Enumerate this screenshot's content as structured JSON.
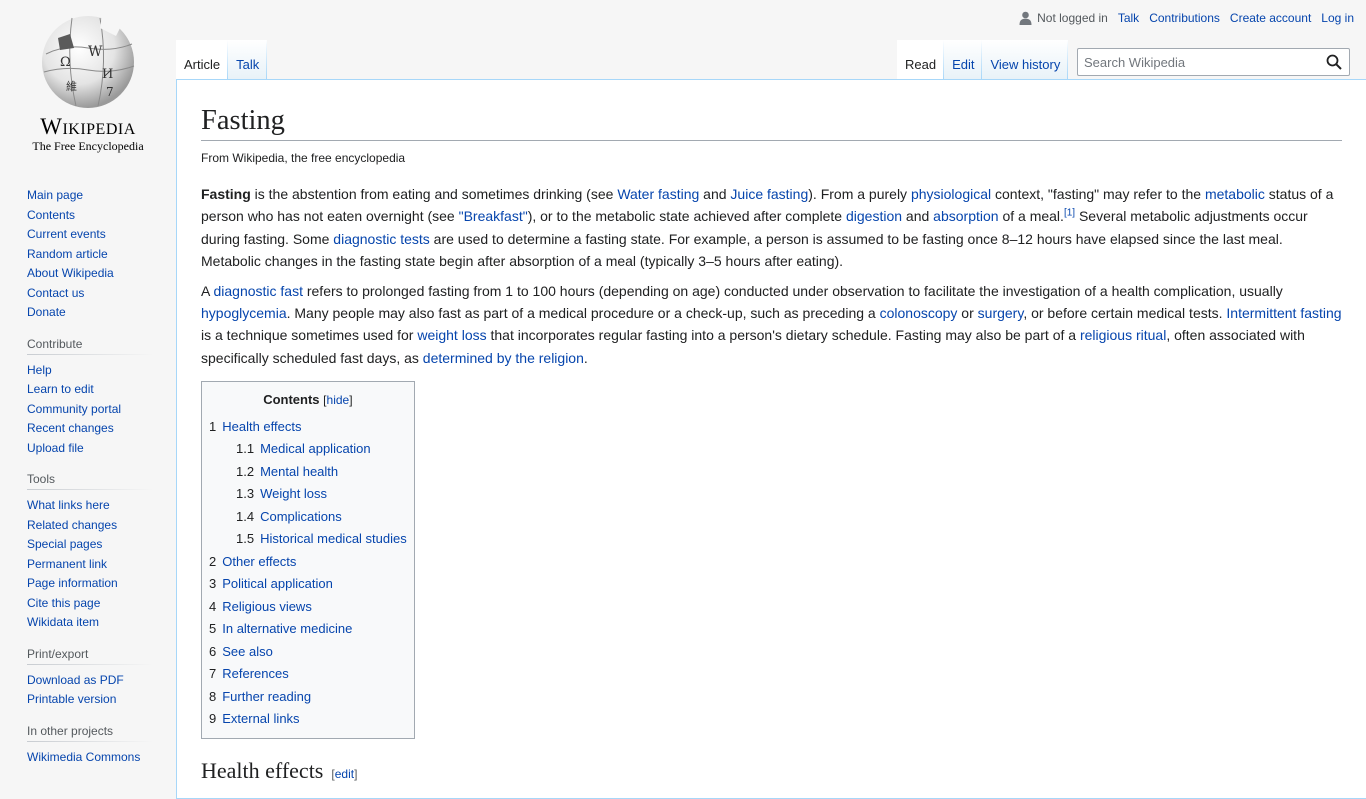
{
  "personal": {
    "status": "Not logged in",
    "links": [
      "Talk",
      "Contributions",
      "Create account",
      "Log in"
    ]
  },
  "logo": {
    "wordmark": "Wikipedia",
    "tagline": "The Free Encyclopedia"
  },
  "sidebar": {
    "navigation": [
      "Main page",
      "Contents",
      "Current events",
      "Random article",
      "About Wikipedia",
      "Contact us",
      "Donate"
    ],
    "contribute": {
      "heading": "Contribute",
      "items": [
        "Help",
        "Learn to edit",
        "Community portal",
        "Recent changes",
        "Upload file"
      ]
    },
    "tools": {
      "heading": "Tools",
      "items": [
        "What links here",
        "Related changes",
        "Special pages",
        "Permanent link",
        "Page information",
        "Cite this page",
        "Wikidata item"
      ]
    },
    "print": {
      "heading": "Print/export",
      "items": [
        "Download as PDF",
        "Printable version"
      ]
    },
    "projects": {
      "heading": "In other projects",
      "items": [
        "Wikimedia Commons"
      ]
    }
  },
  "tabs": {
    "namespaces": [
      {
        "label": "Article",
        "selected": true
      },
      {
        "label": "Talk",
        "selected": false
      }
    ],
    "views": [
      {
        "label": "Read",
        "selected": true
      },
      {
        "label": "Edit",
        "selected": false
      },
      {
        "label": "View history",
        "selected": false
      }
    ]
  },
  "search": {
    "placeholder": "Search Wikipedia",
    "value": ""
  },
  "article": {
    "title": "Fasting",
    "site_sub": "From Wikipedia, the free encyclopedia",
    "paragraphs": [
      [
        {
          "b": "Fasting"
        },
        {
          "t": " is the abstention from eating and sometimes drinking (see "
        },
        {
          "a": "Water fasting"
        },
        {
          "t": " and "
        },
        {
          "a": "Juice fasting"
        },
        {
          "t": "). From a purely "
        },
        {
          "a": "physiological"
        },
        {
          "t": " context, \"fasting\" may refer to the "
        },
        {
          "a": "metabolic"
        },
        {
          "t": " status of a person who has not eaten overnight (see "
        },
        {
          "a": "\"Breakfast\""
        },
        {
          "t": "), or to the metabolic state achieved after complete "
        },
        {
          "a": "digestion"
        },
        {
          "t": " and "
        },
        {
          "a": "absorption"
        },
        {
          "t": " of a meal."
        },
        {
          "sup": "[1]"
        },
        {
          "t": " Several metabolic adjustments occur during fasting. Some "
        },
        {
          "a": "diagnostic tests"
        },
        {
          "t": " are used to determine a fasting state. For example, a person is assumed to be fasting once 8–12 hours have elapsed since the last meal. Metabolic changes in the fasting state begin after absorption of a meal (typically 3–5 hours after eating)."
        }
      ],
      [
        {
          "t": "A "
        },
        {
          "a": "diagnostic fast"
        },
        {
          "t": " refers to prolonged fasting from 1 to 100 hours (depending on age) conducted under observation to facilitate the investigation of a health complication, usually "
        },
        {
          "a": "hypoglycemia"
        },
        {
          "t": ". Many people may also fast as part of a medical procedure or a check-up, such as preceding a "
        },
        {
          "a": "colonoscopy"
        },
        {
          "t": " or "
        },
        {
          "a": "surgery"
        },
        {
          "t": ", or before certain medical tests. "
        },
        {
          "a": "Intermittent fasting"
        },
        {
          "t": " is a technique sometimes used for "
        },
        {
          "a": "weight loss"
        },
        {
          "t": " that incorporates regular fasting into a person's dietary schedule. Fasting may also be part of a "
        },
        {
          "a": "religious ritual"
        },
        {
          "t": ", often associated with specifically scheduled fast days, as "
        },
        {
          "a": "determined by the religion"
        },
        {
          "t": "."
        }
      ]
    ]
  },
  "toc": {
    "title": "Contents",
    "hide_label": "hide",
    "entries": [
      {
        "num": "1",
        "label": "Health effects",
        "level": 1
      },
      {
        "num": "1.1",
        "label": "Medical application",
        "level": 2
      },
      {
        "num": "1.2",
        "label": "Mental health",
        "level": 2
      },
      {
        "num": "1.3",
        "label": "Weight loss",
        "level": 2
      },
      {
        "num": "1.4",
        "label": "Complications",
        "level": 2
      },
      {
        "num": "1.5",
        "label": "Historical medical studies",
        "level": 2
      },
      {
        "num": "2",
        "label": "Other effects",
        "level": 1
      },
      {
        "num": "3",
        "label": "Political application",
        "level": 1
      },
      {
        "num": "4",
        "label": "Religious views",
        "level": 1
      },
      {
        "num": "5",
        "label": "In alternative medicine",
        "level": 1
      },
      {
        "num": "6",
        "label": "See also",
        "level": 1
      },
      {
        "num": "7",
        "label": "References",
        "level": 1
      },
      {
        "num": "8",
        "label": "Further reading",
        "level": 1
      },
      {
        "num": "9",
        "label": "External links",
        "level": 1
      }
    ]
  },
  "next_section": {
    "heading": "Health effects",
    "edit_label": "edit"
  },
  "colors": {
    "link": "#0645ad",
    "text": "#202122",
    "border": "#a7d7f9",
    "background": "#f6f6f6"
  }
}
